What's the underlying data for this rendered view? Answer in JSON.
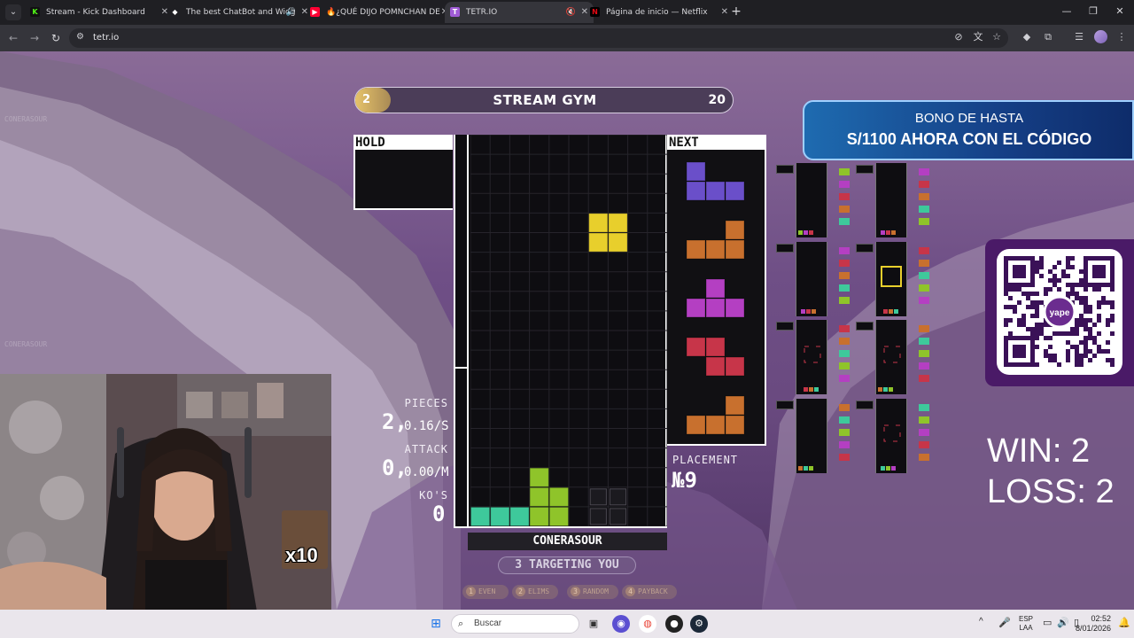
{
  "browser": {
    "tabs": [
      {
        "title": "Stream - Kick Dashboard",
        "favicon": "kick-icon",
        "color": "#53fc18",
        "fav_char": "K"
      },
      {
        "title": "The best ChatBot and Widg",
        "favicon": "botrix-icon",
        "color": "#ffffff",
        "fav_char": "◆"
      },
      {
        "title": "🔥¿QUÉ DIJO POMNCHAN DE",
        "favicon": "youtube-icon",
        "color": "#ff0033",
        "fav_char": "▶"
      },
      {
        "title": "TETR.IO",
        "favicon": "tetrio-icon",
        "color": "#a05bd6",
        "fav_char": "T"
      },
      {
        "title": "Página de inicio — Netflix",
        "favicon": "netflix-icon",
        "color": "#e50914",
        "fav_char": "N"
      }
    ],
    "url": "tetr.io"
  },
  "game": {
    "level": "2",
    "mode_title": "STREAM GYM",
    "goal": "20",
    "hold_label": "HOLD",
    "next_label": "NEXT",
    "stats": {
      "pieces_label": "PIECES",
      "pieces_count": "2,",
      "pieces_rate": "0.16/S",
      "attack_label": "ATTACK",
      "attack_count": "0,",
      "attack_rate": "0.00/M",
      "kos_label": "KO'S",
      "kos_count": "0"
    },
    "placement_label": "PLACEMENT",
    "placement_value": "№9",
    "player_name": "CONERASOUR",
    "targeting_text": "3 TARGETING YOU",
    "strategies": [
      {
        "num": "1",
        "label": "EVEN"
      },
      {
        "num": "2",
        "label": "ELIMS"
      },
      {
        "num": "3",
        "label": "RANDOM"
      },
      {
        "num": "4",
        "label": "PAYBACK"
      }
    ],
    "next_queue": [
      "J",
      "L",
      "T",
      "Z",
      "L"
    ],
    "piece_colors": {
      "J": "#6a4fc9",
      "L": "#c8702e",
      "T": "#b43fc2",
      "Z": "#c73549",
      "O": "#e8cf2c",
      "S": "#8fc42a",
      "I": "#3ec99b",
      "G": "#2a2a2e"
    }
  },
  "overlay": {
    "promo_line1": "BONO DE HASTA",
    "promo_line2": "S/1100 AHORA CON EL CÓDIGO",
    "qr_brand": "yape",
    "win_text": "WIN: 2",
    "loss_text": "LOSS: 2",
    "emote_text": "x10",
    "ghost_name": "CONERASOUR"
  },
  "taskbar": {
    "search_placeholder": "Buscar",
    "lang_top": "ESP",
    "lang_bottom": "LAA",
    "time": "02:52",
    "date": "8/01/2026"
  }
}
